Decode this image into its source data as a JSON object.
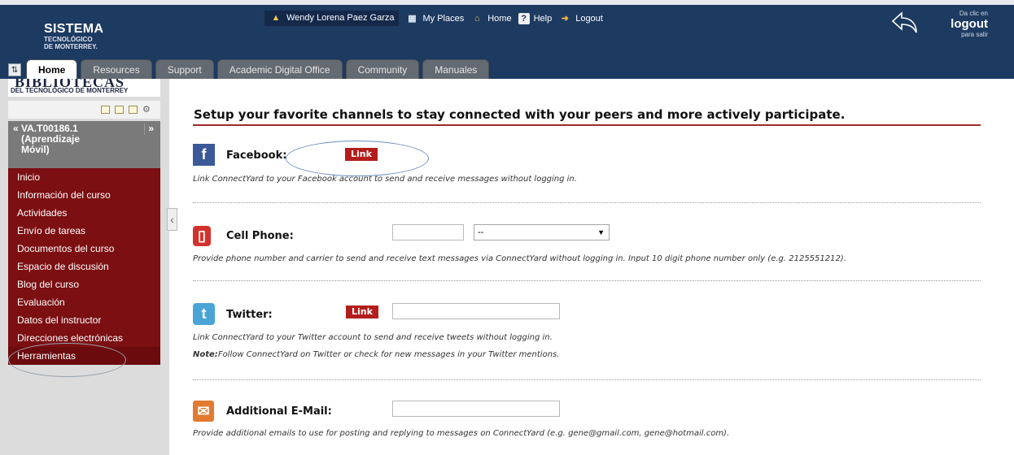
{
  "header": {
    "logo": {
      "line1": "SISTEMA",
      "line2": "TECNOLÓGICO",
      "line3": "DE MONTERREY."
    },
    "nav": {
      "user": "Wendy Lorena Paez Garza",
      "places": "My Places",
      "home": "Home",
      "help": "Help",
      "logout": "Logout"
    },
    "logout_box": {
      "top": "Da clic en",
      "main": "logout",
      "bottom": "para salir"
    }
  },
  "tabs": [
    "Home",
    "Resources",
    "Support",
    "Academic Digital Office",
    "Community",
    "Manuales"
  ],
  "sidebar": {
    "library_banner": {
      "big": "BIBLIOTECAS",
      "sub": "DEL TECNOLÓGICO DE MONTERREY"
    },
    "course": {
      "line1": "VA.T00186.1",
      "line2": "(Aprendizaje",
      "line3": "Móvil)"
    },
    "menu": [
      "Inicio",
      "Información del curso",
      "Actividades",
      "Envío de tareas",
      "Documentos del curso",
      "Espacio de discusión",
      "Blog del curso",
      "Evaluación",
      "Datos del instructor",
      "Direcciones electrónicas",
      "Herramientas"
    ]
  },
  "main": {
    "title": "Setup your favorite channels to stay connected with your peers and more actively participate.",
    "facebook": {
      "label": "Facebook:",
      "button": "Link",
      "desc": "Link ConnectYard to your Facebook account to send and receive messages without logging in."
    },
    "cell": {
      "label": "Cell Phone:",
      "phone_value": "",
      "carrier_value": "--",
      "desc": "Provide phone number and carrier to send and receive text messages via ConnectYard without logging in. Input 10 digit phone number only (e.g. 2125551212)."
    },
    "twitter": {
      "label": "Twitter:",
      "button": "Link",
      "value": "",
      "desc": "Link ConnectYard to your Twitter account to send and receive tweets without logging in.",
      "note_label": "Note:",
      "note": "Follow ConnectYard on Twitter or check for new messages in your Twitter mentions."
    },
    "email": {
      "label": "Additional E-Mail:",
      "value": "",
      "desc": "Provide additional emails to use for posting and replying to messages on ConnectYard (e.g. gene@gmail.com, gene@hotmail.com)."
    }
  },
  "icons": {
    "facebook": "facebook-icon",
    "cell": "cell-phone-icon",
    "twitter": "twitter-icon",
    "email": "email-icon"
  },
  "colors": {
    "header_bg": "#1d3a61",
    "menu_bg": "#7b0f12",
    "link_button": "#b31d1d",
    "title_rule": "#9e2a2a",
    "facebook": "#3b5998",
    "cell": "#d2322d",
    "twitter": "#4aa5d6",
    "email": "#e27a2f"
  }
}
